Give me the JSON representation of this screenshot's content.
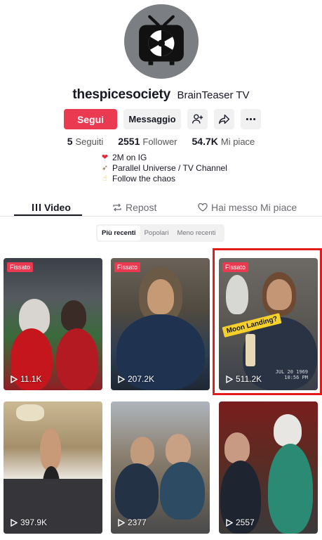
{
  "profile": {
    "username": "thespicesociety",
    "nickname": "BrainTeaser TV",
    "follow_label": "Segui",
    "message_label": "Messaggio",
    "stats": [
      {
        "value": "5",
        "label": "Seguiti"
      },
      {
        "value": "2551",
        "label": "Follower"
      },
      {
        "value": "54.7K",
        "label": "Mi piace"
      }
    ],
    "bio": [
      {
        "emoji": "❤️",
        "text": "2M on IG"
      },
      {
        "emoji": "🚀",
        "text": "Parallel Universe / TV Channel"
      },
      {
        "emoji": "👆",
        "text": "Follow the chaos"
      }
    ]
  },
  "tabs": [
    {
      "label": "Video",
      "icon": "video-grid-icon",
      "active": true
    },
    {
      "label": "Repost",
      "icon": "repost-icon",
      "active": false
    },
    {
      "label": "Hai messo Mi piace",
      "icon": "heart-lock-icon",
      "active": false
    }
  ],
  "filters": [
    {
      "label": "Più recenti",
      "active": true
    },
    {
      "label": "Popolari",
      "active": false
    },
    {
      "label": "Meno recenti",
      "active": false
    }
  ],
  "pinned_label": "Fissato",
  "videos": [
    {
      "views": "11.1K",
      "pinned": true
    },
    {
      "views": "207.2K",
      "pinned": true
    },
    {
      "views": "511.2K",
      "pinned": true,
      "sticker": "Moon Landing?",
      "stamp": [
        "JUL 20 1969",
        "10:56 PM"
      ],
      "highlighted": true
    },
    {
      "views": "397.9K",
      "pinned": false
    },
    {
      "views": "2377",
      "pinned": false
    },
    {
      "views": "2557",
      "pinned": false
    }
  ],
  "colors": {
    "accent": "#ea3a52",
    "highlight": "#e51b1b"
  }
}
